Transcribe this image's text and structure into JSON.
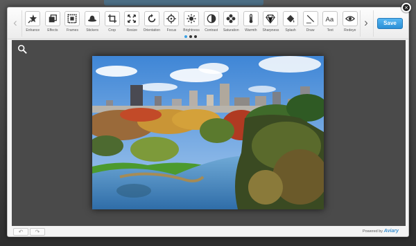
{
  "toolbar": {
    "tools": [
      {
        "label": "Enhance",
        "icon": "star-wand-icon"
      },
      {
        "label": "Effects",
        "icon": "effects-icon"
      },
      {
        "label": "Frames",
        "icon": "frame-icon"
      },
      {
        "label": "Stickers",
        "icon": "hat-icon"
      },
      {
        "label": "Crop",
        "icon": "crop-icon"
      },
      {
        "label": "Resize",
        "icon": "resize-arrows-icon"
      },
      {
        "label": "Orientation",
        "icon": "rotate-icon"
      },
      {
        "label": "Focus",
        "icon": "focus-target-icon"
      },
      {
        "label": "Brightness",
        "icon": "sun-icon"
      },
      {
        "label": "Contrast",
        "icon": "contrast-icon"
      },
      {
        "label": "Saturation",
        "icon": "flower-icon"
      },
      {
        "label": "Warmth",
        "icon": "thermometer-icon"
      },
      {
        "label": "Sharpness",
        "icon": "diamond-icon"
      },
      {
        "label": "Splash",
        "icon": "paint-bucket-icon"
      },
      {
        "label": "Draw",
        "icon": "pencil-icon"
      },
      {
        "label": "Text",
        "icon": "text-icon"
      },
      {
        "label": "Redeye",
        "icon": "eye-icon"
      }
    ],
    "prev_arrow": "‹",
    "next_arrow": "›",
    "save_label": "Save",
    "page_dots": [
      true,
      false,
      false
    ]
  },
  "close_symbol": "×",
  "footer": {
    "undo_symbol": "↶",
    "redo_symbol": "↷",
    "powered_by": "Powered by",
    "brand": "Aviary"
  },
  "colors": {
    "accent": "#2a8fd6",
    "active_dot": "#3aa0e3",
    "canvas_bg": "#4a4a4a"
  }
}
